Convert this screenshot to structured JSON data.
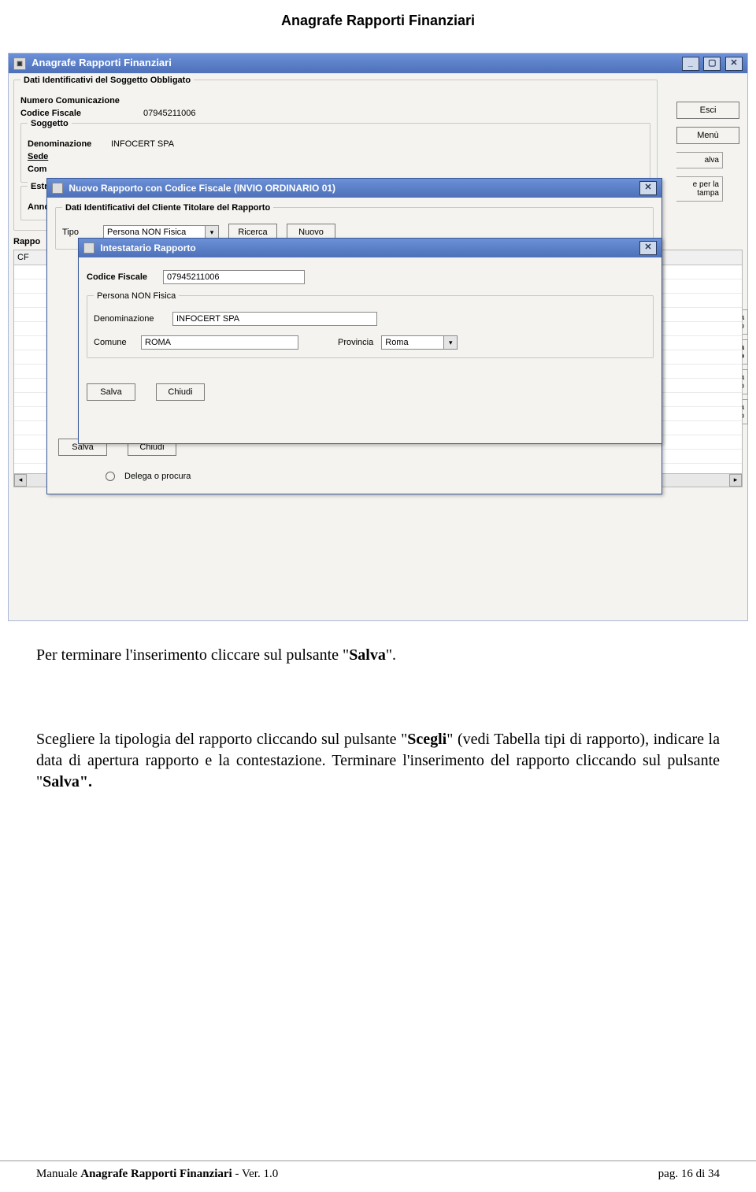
{
  "doc": {
    "header_title": "Anagrafe Rapporti Finanziari",
    "para1_pre": "Per terminare l'inserimento cliccare sul pulsante \"",
    "para1_bold": "Salva",
    "para1_post": "\".",
    "para2_pre": "Scegliere la tipologia del rapporto cliccando sul pulsante \"",
    "para2_bold1": "Scegli",
    "para2_mid": "\" (vedi Tabella tipi di rapporto), indicare la data di apertura rapporto e la contestazione. Terminare l'inserimento del rapporto cliccando sul pulsante \"",
    "para2_bold2": "Salva\".",
    "footer_left_pre": "Manuale ",
    "footer_left_bold": "Anagrafe Rapporti Finanziari",
    "footer_left_post": " - Ver. 1.0",
    "footer_right": "pag. 16 di 34"
  },
  "mainwin": {
    "title": "Anagrafe Rapporti Finanziari",
    "group1": "Dati Identificativi del Soggetto Obbligato",
    "lbl_numcom": "Numero Comunicazione",
    "lbl_cf": "Codice Fiscale",
    "val_cf": "07945211006",
    "group_sogg": "Soggetto",
    "lbl_denom": "Denominazione",
    "val_denom": "INFOCERT SPA",
    "lbl_sede": "Sede",
    "lbl_com": "Com",
    "group_estr": "Estre",
    "lbl_anno": "Anno c",
    "rapporti_label": "Rappo",
    "col_cf": "CF",
    "btn_esci": "Esci",
    "btn_menu": "Menù",
    "btn_salva_cut": "alva",
    "btn_stampa_l1": "e per la",
    "btn_stampa_l2": "tampa",
    "pbtn_cerca": "cerca",
    "pbtn_rapporto": "apporto",
    "pbtn_crea": "Crea",
    "pbtn_modifica": "odifica",
    "pbtn_elimina": "limina"
  },
  "modal1": {
    "title": "Nuovo Rapporto con Codice Fiscale (INVIO ORDINARIO 01)",
    "group": "Dati Identificativi del Cliente Titolare del Rapporto",
    "lbl_tipo": "Tipo",
    "val_tipo": "Persona NON Fisica",
    "btn_ricerca": "Ricerca",
    "btn_nuovo": "Nuovo",
    "radio_delega": "Delega o procura",
    "btn_salva": "Salva",
    "btn_chiudi": "Chiudi"
  },
  "modal2": {
    "title": "Intestatario Rapporto",
    "lbl_cf": "Codice Fiscale",
    "val_cf": "07945211006",
    "group_pnf": "Persona NON Fisica",
    "lbl_denom": "Denominazione",
    "val_denom": "INFOCERT SPA",
    "lbl_comune": "Comune",
    "val_comune": "ROMA",
    "lbl_prov": "Provincia",
    "val_prov": "Roma",
    "btn_salva": "Salva",
    "btn_chiudi": "Chiudi"
  }
}
